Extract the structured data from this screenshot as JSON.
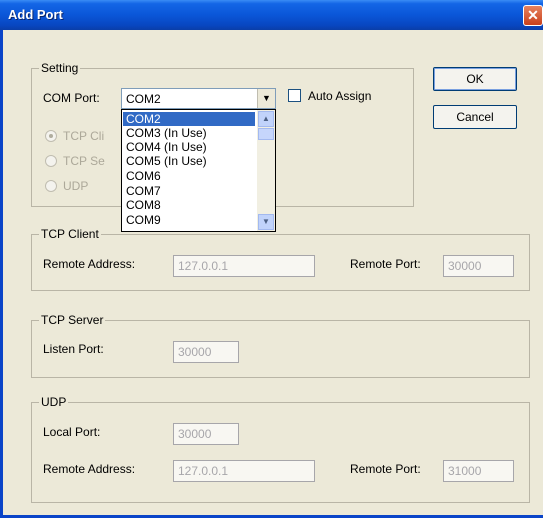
{
  "window": {
    "title": "Add Port",
    "close_glyph": "✕"
  },
  "setting": {
    "legend": "Setting",
    "com_port_label": "COM Port:",
    "com_port_value": "COM2",
    "auto_assign_label": "Auto Assign",
    "radios": [
      "TCP Cli",
      "TCP Se",
      "UDP"
    ]
  },
  "dropdown": {
    "options": [
      "COM2",
      "COM3 (In Use)",
      "COM4 (In Use)",
      "COM5 (In Use)",
      "COM6",
      "COM7",
      "COM8",
      "COM9"
    ],
    "selected_index": 0
  },
  "buttons": {
    "ok": "OK",
    "cancel": "Cancel"
  },
  "tcp_client": {
    "legend": "TCP Client",
    "remote_address_label": "Remote Address:",
    "remote_address_value": "127.0.0.1",
    "remote_port_label": "Remote Port:",
    "remote_port_value": "30000"
  },
  "tcp_server": {
    "legend": "TCP Server",
    "listen_port_label": "Listen Port:",
    "listen_port_value": "30000"
  },
  "udp": {
    "legend": "UDP",
    "local_port_label": "Local Port:",
    "local_port_value": "30000",
    "remote_address_label": "Remote Address:",
    "remote_address_value": "127.0.0.1",
    "remote_port_label": "Remote Port:",
    "remote_port_value": "31000"
  },
  "colors": {
    "titlebar": "#0a56d8",
    "selection": "#316ac5",
    "dialog_bg": "#ece9d8"
  }
}
